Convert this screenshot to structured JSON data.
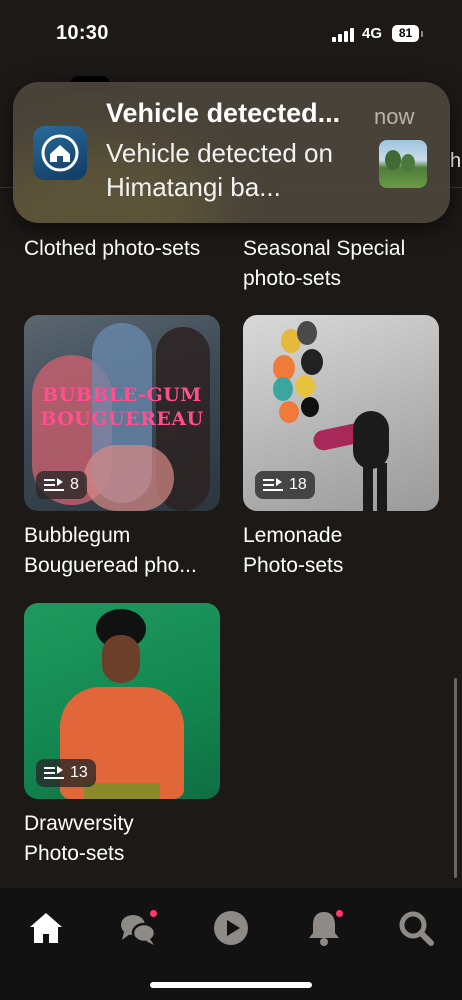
{
  "status_bar": {
    "time": "10:30",
    "network": "4G",
    "battery": "81"
  },
  "notification": {
    "title": "Vehicle detected...",
    "body": "Vehicle detected on Himatangi ba...",
    "time": "now",
    "app_icon": "home-app-icon"
  },
  "peek_text": "h",
  "sections": [
    {
      "title": "Clothed photo-sets"
    },
    {
      "title": "Seasonal Special photo-sets"
    }
  ],
  "cards": [
    {
      "title_line1": "Bubblegum",
      "title_line2": "Bougueread pho...",
      "overlay": "BUBBLE-GUM\nBOUGUEREAU",
      "count": "8"
    },
    {
      "title_line1": "Lemonade",
      "title_line2": "Photo-sets",
      "count": "18"
    },
    {
      "title_line1": "Drawversity",
      "title_line2": "Photo-sets",
      "count": "13"
    }
  ],
  "tab_bar": {
    "items": [
      {
        "name": "home",
        "icon": "home-icon",
        "active": true
      },
      {
        "name": "messages",
        "icon": "chat-bubbles-icon",
        "badge": true
      },
      {
        "name": "videos",
        "icon": "play-icon"
      },
      {
        "name": "notifications",
        "icon": "bell-icon",
        "badge": true
      },
      {
        "name": "search",
        "icon": "search-icon"
      }
    ],
    "badge_color": "#ff3b6b"
  },
  "colors": {
    "background": "#1c1917",
    "tab_bar": "#121212",
    "badge": "#ff3b6b"
  }
}
